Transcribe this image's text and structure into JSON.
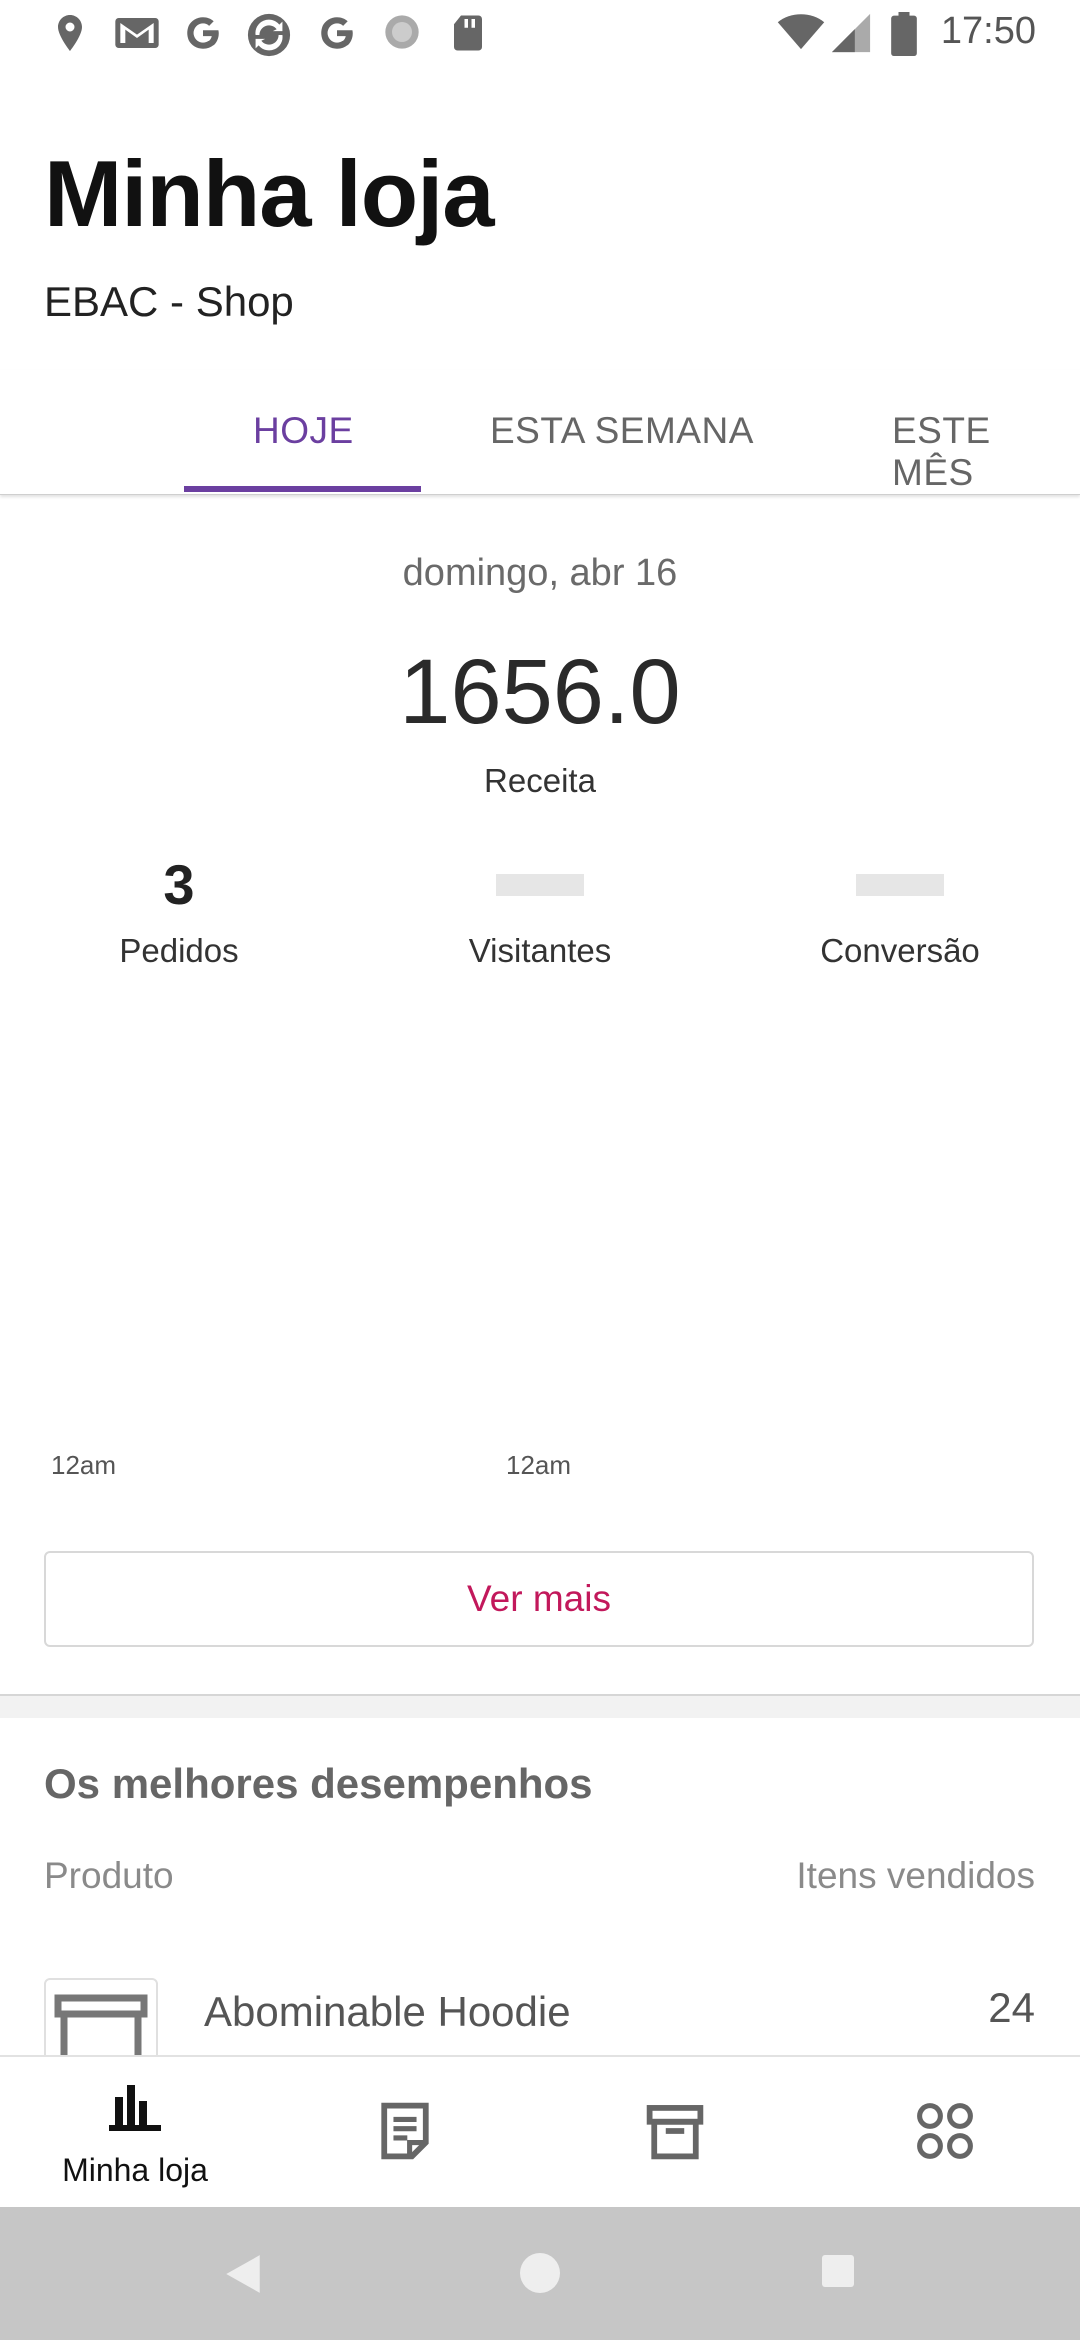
{
  "status_bar": {
    "time": "17:50",
    "icons": [
      "location-icon",
      "gmail-icon",
      "google-icon",
      "sync-icon",
      "google-icon",
      "loading-icon",
      "sd-card-icon",
      "wifi-icon",
      "signal-icon",
      "battery-icon"
    ]
  },
  "header": {
    "title": "Minha loja",
    "store_name": "EBAC - Shop"
  },
  "tabs": [
    {
      "label": "HOJE",
      "selected": true
    },
    {
      "label": "ESTA SEMANA",
      "selected": false
    },
    {
      "label": "ESTE MÊS",
      "selected": false
    }
  ],
  "stats": {
    "date": "domingo, abr 16",
    "revenue_value": "1656.0",
    "revenue_label": "Receita",
    "orders_value": "3",
    "orders_label": "Pedidos",
    "visitors_label": "Visitantes",
    "conversion_label": "Conversão"
  },
  "chart": {
    "x_ticks": [
      "12am",
      "12am"
    ]
  },
  "buttons": {
    "see_more": "Ver mais"
  },
  "top_performers": {
    "title": "Os melhores desempenhos",
    "col_product": "Produto",
    "col_items_sold": "Itens vendidos",
    "items": [
      {
        "name": "Abominable Hoodie",
        "sold": "24"
      }
    ]
  },
  "bottom_nav": {
    "my_store_label": "Minha loja"
  },
  "colors": {
    "accent": "#6b3fa0",
    "button_text": "#c2185b",
    "system_nav": "#c6c6c6"
  }
}
